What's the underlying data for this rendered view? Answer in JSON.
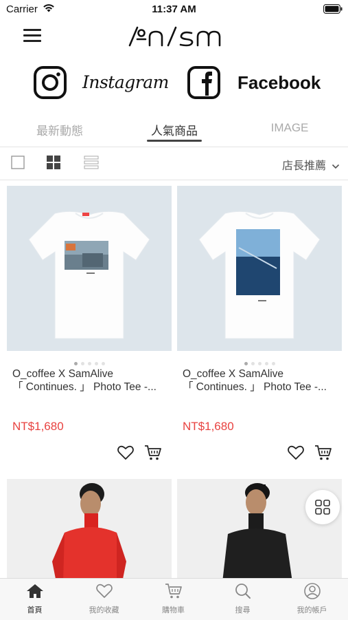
{
  "status_bar": {
    "carrier": "Carrier",
    "time": "11:37 AM"
  },
  "brand": {
    "logo_text": "/ºn/sm"
  },
  "social": {
    "instagram": "Instagram",
    "facebook": "Facebook"
  },
  "tabs": [
    {
      "label": "最新動態",
      "active": false
    },
    {
      "label": "人氣商品",
      "active": true
    },
    {
      "label": "IMAGE",
      "active": false
    }
  ],
  "toolbar": {
    "sort_label": "店長推薦"
  },
  "products": [
    {
      "title_line1": "O_coffee X SamAlive",
      "title_line2": "「 Continues. 」 Photo Tee -...",
      "price": "NT$1,680"
    },
    {
      "title_line1": "O_coffee X SamAlive",
      "title_line2": "「 Continues. 」 Photo Tee -...",
      "price": "NT$1,680"
    }
  ],
  "tabbar": [
    {
      "label": "首頁",
      "icon": "home-icon",
      "active": true
    },
    {
      "label": "我的收藏",
      "icon": "heart-icon",
      "active": false
    },
    {
      "label": "購物車",
      "icon": "cart-icon",
      "active": false
    },
    {
      "label": "搜尋",
      "icon": "search-icon",
      "active": false
    },
    {
      "label": "我的帳戶",
      "icon": "account-icon",
      "active": false
    }
  ],
  "colors": {
    "price": "#e8413f",
    "accent_dark": "#222222",
    "muted": "#aaaaaa"
  }
}
